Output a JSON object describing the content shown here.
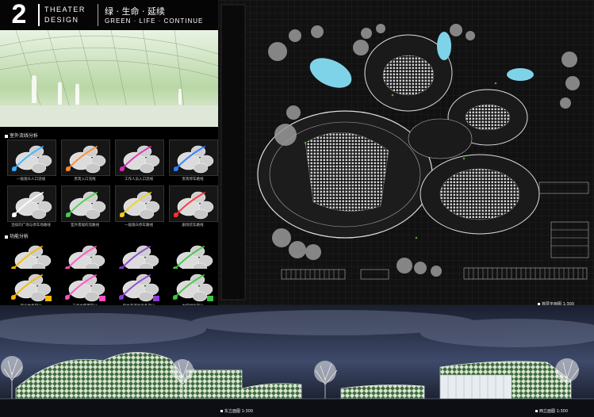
{
  "header": {
    "number": "2",
    "subtitle_line1": "THEATER",
    "subtitle_line2": "DESIGN",
    "title_cn": "绿 · 生命 · 延续",
    "title_en": "GREEN · LIFE · CONTINUE"
  },
  "sections": {
    "circulation_title": "室外流线分析",
    "function_title": "功能分析"
  },
  "circulation_diagrams": [
    {
      "label": "一般观众人口流线",
      "accent": "#3ab0ff"
    },
    {
      "label": "贵宾入口流线",
      "accent": "#ff8a2a"
    },
    {
      "label": "工作人员入口流线",
      "accent": "#e02ab8"
    },
    {
      "label": "贵宾停车路线",
      "accent": "#2a7bff"
    },
    {
      "label": "连续的广场与停车场路线",
      "accent": "#ffffff"
    },
    {
      "label": "室外景观的流路线",
      "accent": "#4ad04a"
    },
    {
      "label": "一般观众停车路线",
      "accent": "#f0d020"
    },
    {
      "label": "剧场货车路线",
      "accent": "#ff3030"
    }
  ],
  "function_diagrams": [
    {
      "label": "观众休息部分",
      "accent": "#f5b800"
    },
    {
      "label": "工具台使用部分",
      "accent": "#ff4fbf"
    },
    {
      "label": "后台及演出准备部分",
      "accent": "#8b3fd0"
    },
    {
      "label": "中庭绿化部分",
      "accent": "#3ec43e"
    }
  ],
  "captions": {
    "plan": "首层平面图 1:300",
    "elevation_east": "东立面图 1:300",
    "elevation_west": "西立面图 1:300"
  },
  "colors": {
    "background": "#000000",
    "plan_ground": "#1a1a1a",
    "water": "#7fd3e8",
    "greenery": "#4f9a3a",
    "night_sky": "#2b3550"
  }
}
